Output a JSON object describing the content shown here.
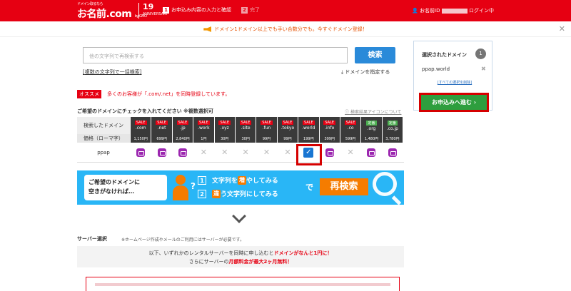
{
  "header": {
    "logo_tagline": "ドメイン取るなら",
    "logo_text": "お名前.com",
    "logo_by": "by GMO",
    "anniversary_num": "19",
    "anniversary_sub": "ANNIVERSARY",
    "steps": [
      {
        "num": "1",
        "label": "お申込み内容の入力と確認"
      },
      {
        "num": "2",
        "label": "完了"
      }
    ],
    "user_prefix": "お名前ID",
    "user_suffix": "ログイン中"
  },
  "notice": {
    "text": "ドメイン1ドメイン以上でも手い合数分でも。今すぐドメイン登録！"
  },
  "search": {
    "placeholder": "他の文字列で再検索する",
    "button": "検索",
    "bulk_link": "複数の文字列で一括検索",
    "specify_link": "ドメインを指定する"
  },
  "recommend": {
    "tag": "オススメ",
    "text": "多くのお客様が「.com/.net」を同時登録しています。"
  },
  "table": {
    "title": "ご希望のドメインにチェックを入れてください ※複数選択可",
    "legend_link": "検索結果アイコンについて",
    "row_domain_label": "検索したドメイン",
    "row_price_label": "価格（ローマ字）",
    "row_query_label": "ppap",
    "columns": [
      {
        "badge": "SALE",
        "tld": ".com",
        "price": "1,150円",
        "status": "mail"
      },
      {
        "badge": "SALE",
        "tld": ".net",
        "price": "699円",
        "status": "mail"
      },
      {
        "badge": "SALE",
        "tld": ".jp",
        "price": "2,840円",
        "status": "mail"
      },
      {
        "badge": "SALE",
        "tld": ".work",
        "price": "1円",
        "status": "unavailable"
      },
      {
        "badge": "SALE",
        "tld": ".xyz",
        "price": "30円",
        "status": "unavailable"
      },
      {
        "badge": "SALE",
        "tld": ".site",
        "price": "30円",
        "status": "unavailable"
      },
      {
        "badge": "SALE",
        "tld": ".fun",
        "price": "99円",
        "status": "unavailable"
      },
      {
        "badge": "SALE",
        "tld": ".tokyo",
        "price": "99円",
        "status": "unavailable"
      },
      {
        "badge": "SALE",
        "tld": ".world",
        "price": "199円",
        "status": "checked"
      },
      {
        "badge": "SALE",
        "tld": ".info",
        "price": "399円",
        "status": "mail"
      },
      {
        "badge": "SALE",
        "tld": ".co",
        "price": "599円",
        "status": "unavailable"
      },
      {
        "badge": "定番",
        "tld": ".org",
        "price": "1,480円",
        "status": "mail"
      },
      {
        "badge": "定番",
        "tld": ".co.jp",
        "price": "3,780円",
        "status": "mail"
      }
    ]
  },
  "banner": {
    "line1": "ご希望のドメインに",
    "line2": "空きがなければ…",
    "q": "?",
    "opt1_num": "1",
    "opt1_a": "文字列を",
    "opt1_em": "増",
    "opt1_b": "やしてみる",
    "opt2_num": "2",
    "opt2_em": "違",
    "opt2_b": "う文字列にしてみる",
    "de": "で",
    "button": "再検索"
  },
  "server": {
    "label": "サーバー選択",
    "note": "※ホームページ作成やメールのご利用にはサーバーが必要です。",
    "line1_a": "以下、いずれかのレンタルサーバーを同時に申し込むと",
    "line1_red": "ドメインがなんと1円に！",
    "line2_a": "さらにサーバーの",
    "line2_red": "月額料金が最大2ヶ月無料！"
  },
  "sidebar": {
    "title": "選択されたドメイン",
    "count": "1",
    "domain": "ppap.world",
    "remove": "✖",
    "clear_link": "[すべての選択を削除]",
    "apply_button": "お申込みへ進む ›"
  },
  "icons": {
    "close": "✕"
  }
}
